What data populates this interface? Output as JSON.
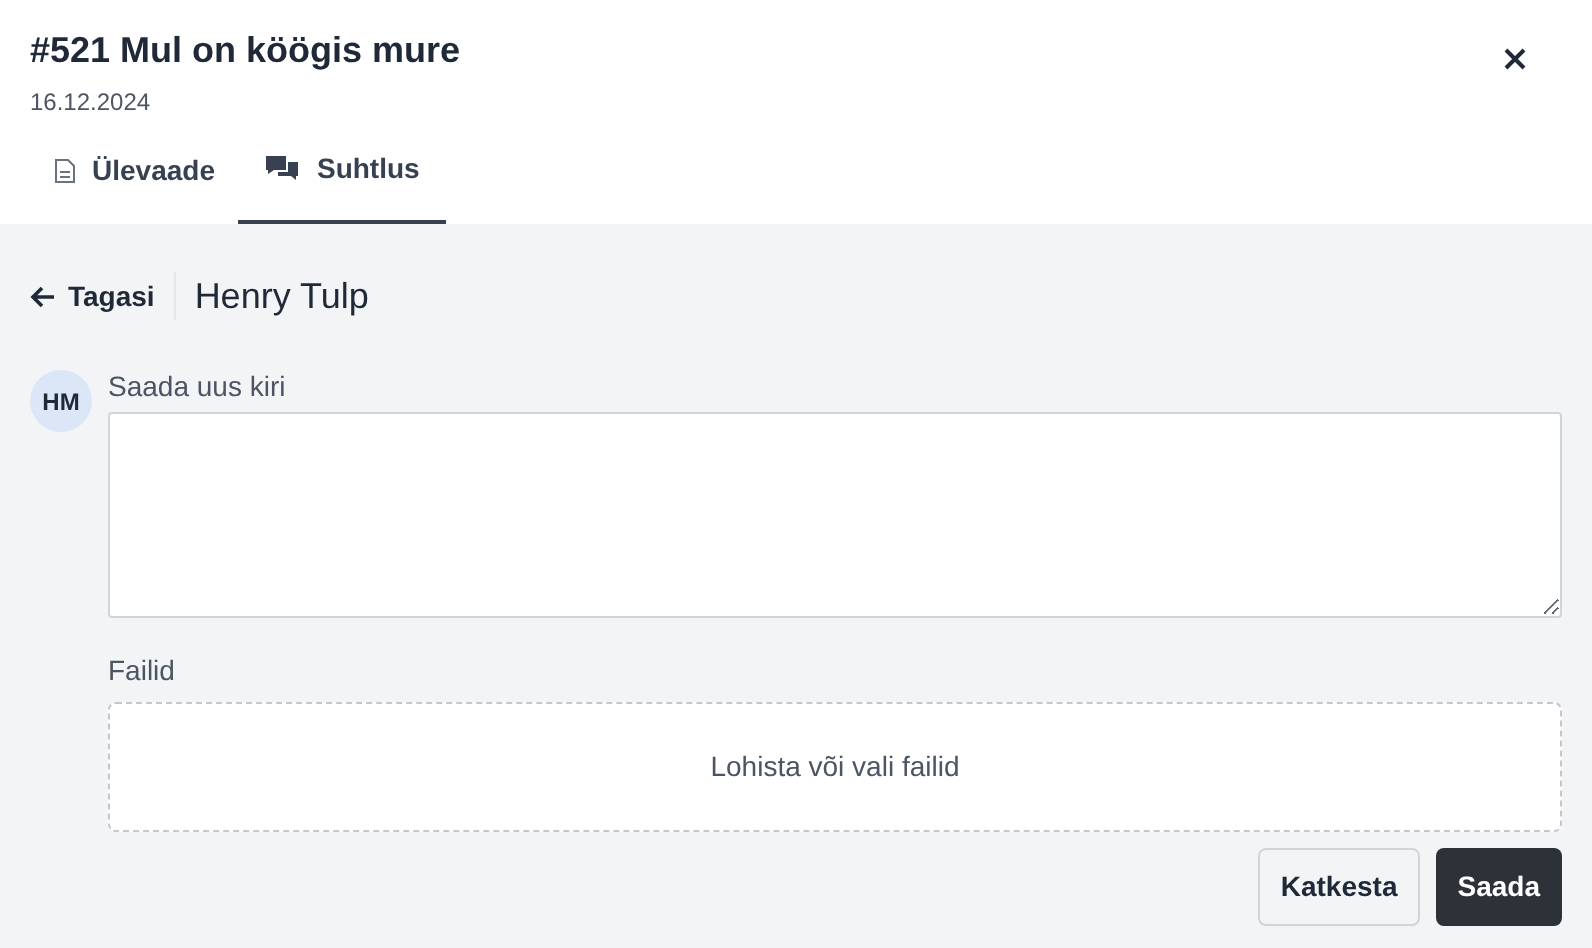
{
  "header": {
    "title": "#521 Mul on köögis mure",
    "date": "16.12.2024"
  },
  "tabs": [
    {
      "label": "Ülevaade",
      "kind": "document",
      "selected": false
    },
    {
      "label": "Suhtlus",
      "kind": "chat",
      "selected": true
    }
  ],
  "conversation": {
    "back_label": "Tagasi",
    "contact_name": "Henry Tulp"
  },
  "compose": {
    "avatar_initials": "HM",
    "message_label": "Saada uus kiri",
    "files_label": "Failid",
    "dropzone_text": "Lohista või vali failid"
  },
  "buttons": [
    {
      "label": "Katkesta",
      "kind": "secondary"
    },
    {
      "label": "Saada",
      "kind": "primary"
    }
  ]
}
